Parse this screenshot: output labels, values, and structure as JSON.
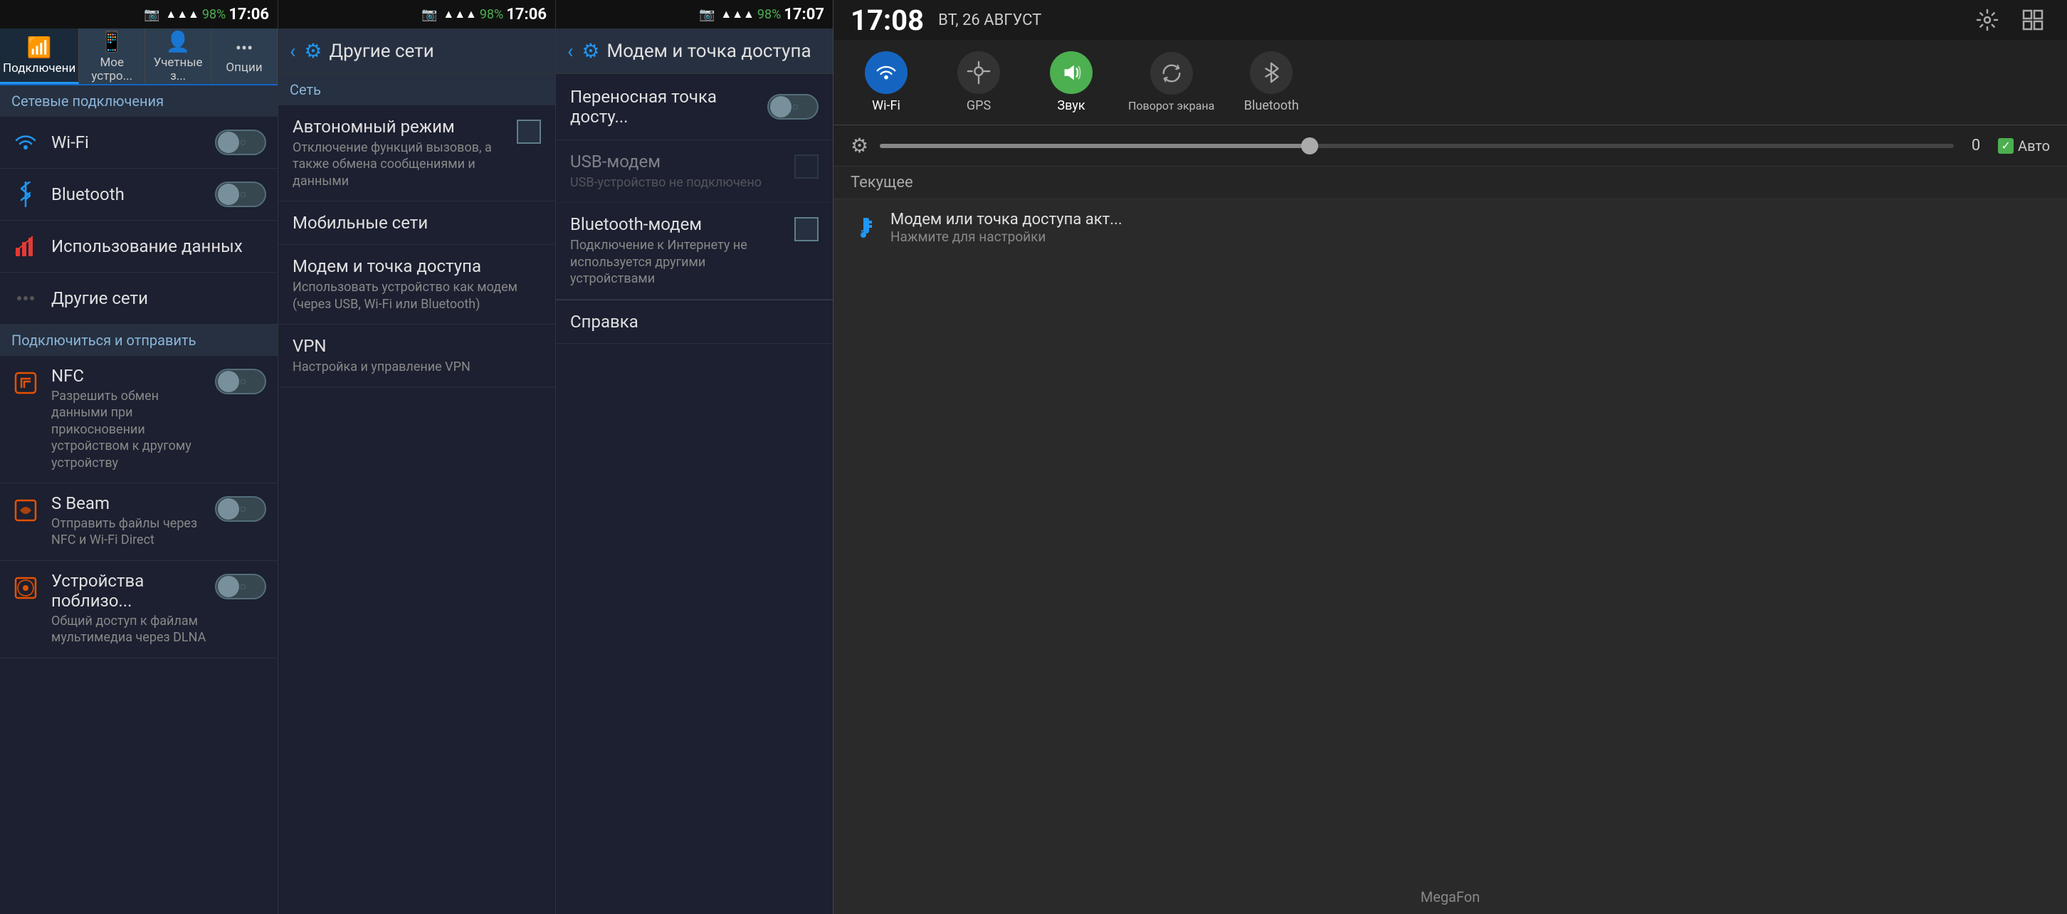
{
  "panel1": {
    "statusBar": {
      "signal": "▲▲▲",
      "battery": "98%",
      "batteryIcon": "🔋",
      "time": "17:06",
      "cameraIcon": "📷"
    },
    "tabs": [
      {
        "label": "Подключени",
        "icon": "📶",
        "active": true
      },
      {
        "label": "Мое устро...",
        "icon": "📱",
        "active": false
      },
      {
        "label": "Учетные з...",
        "icon": "👤",
        "active": false
      },
      {
        "label": "Опции",
        "icon": "⋯",
        "active": false
      }
    ],
    "sectionHeader": "Сетевые подключения",
    "rows": [
      {
        "id": "wifi",
        "title": "Wi-Fi",
        "icon": "wifi",
        "hasToggle": true,
        "toggleState": "off"
      },
      {
        "id": "bluetooth",
        "title": "Bluetooth",
        "icon": "bluetooth",
        "hasToggle": true,
        "toggleState": "off"
      },
      {
        "id": "data-usage",
        "title": "Использование данных",
        "icon": "data",
        "hasToggle": false
      },
      {
        "id": "other-networks",
        "title": "Другие сети",
        "icon": "more",
        "hasToggle": false
      }
    ],
    "section2Header": "Подключиться и отправить",
    "rows2": [
      {
        "id": "nfc",
        "title": "NFC",
        "desc": "Разрешить обмен данными при прикосновении устройством к другому устройству",
        "hasToggle": true,
        "toggleState": "off"
      },
      {
        "id": "sbeam",
        "title": "S Beam",
        "desc": "Отправить файлы через NFC и Wi-Fi Direct",
        "hasToggle": true,
        "toggleState": "off"
      },
      {
        "id": "nearby",
        "title": "Устройства поблизо...",
        "desc": "Общий доступ к файлам мультимедиа через DLNA",
        "hasToggle": true,
        "toggleState": "off"
      }
    ]
  },
  "panel2": {
    "statusBar": {
      "time": "17:06"
    },
    "header": {
      "title": "Другие сети",
      "backLabel": "‹",
      "gearIcon": "⚙"
    },
    "sectionHeader": "Сеть",
    "rows": [
      {
        "id": "airplane",
        "title": "Автономный режим",
        "desc": "Отключение функций вызовов, а также обмена сообщениями и данными",
        "hasCheckbox": true
      },
      {
        "id": "mobile-networks",
        "title": "Мобильные сети",
        "desc": "",
        "hasCheckbox": false
      },
      {
        "id": "tethering",
        "title": "Модем и точка доступа",
        "desc": "Использовать устройство как модем (через USB, Wi-Fi или Bluetooth)",
        "hasCheckbox": false
      },
      {
        "id": "vpn",
        "title": "VPN",
        "desc": "Настройка и управление VPN",
        "hasCheckbox": false
      }
    ]
  },
  "panel3": {
    "statusBar": {
      "time": "17:07"
    },
    "header": {
      "title": "Модем и точка доступа",
      "backLabel": "‹",
      "gearIcon": "⚙"
    },
    "rows": [
      {
        "id": "portable-hotspot",
        "title": "Переносная точка досту...",
        "desc": "",
        "hasToggle": true,
        "toggleState": "off"
      },
      {
        "id": "usb-modem",
        "title": "USB-модем",
        "desc": "USB-устройство не подключено",
        "hasCheckbox": true,
        "disabled": true
      },
      {
        "id": "bt-modem",
        "title": "Bluetooth-модем",
        "desc": "Подключение к Интернету не используется другими устройствами",
        "hasCheckbox": true,
        "disabled": false
      },
      {
        "id": "help",
        "title": "Справка",
        "desc": "",
        "hasCheckbox": false
      }
    ]
  },
  "panel4": {
    "statusBar": {
      "time": "17:08",
      "date": "ВТ, 26 АВГУСТ"
    },
    "tiles": [
      {
        "id": "wifi",
        "label": "Wi-Fi",
        "icon": "wifi",
        "active": true
      },
      {
        "id": "gps",
        "label": "GPS",
        "icon": "gps",
        "active": false
      },
      {
        "id": "sound",
        "label": "Звук",
        "icon": "sound",
        "active": true
      },
      {
        "id": "rotate",
        "label": "Поворот экрана",
        "icon": "rotate",
        "active": false
      },
      {
        "id": "bluetooth",
        "label": "Bluetooth",
        "icon": "bluetooth",
        "active": false
      }
    ],
    "brightness": {
      "value": "0",
      "autoLabel": "Авто",
      "autoChecked": true
    },
    "currentLabel": "Текущее",
    "notification": {
      "icon": "usb",
      "title": "Модем или точка доступа акт...",
      "desc": "Нажмите для настройки"
    },
    "carrier": "MegaFon"
  }
}
